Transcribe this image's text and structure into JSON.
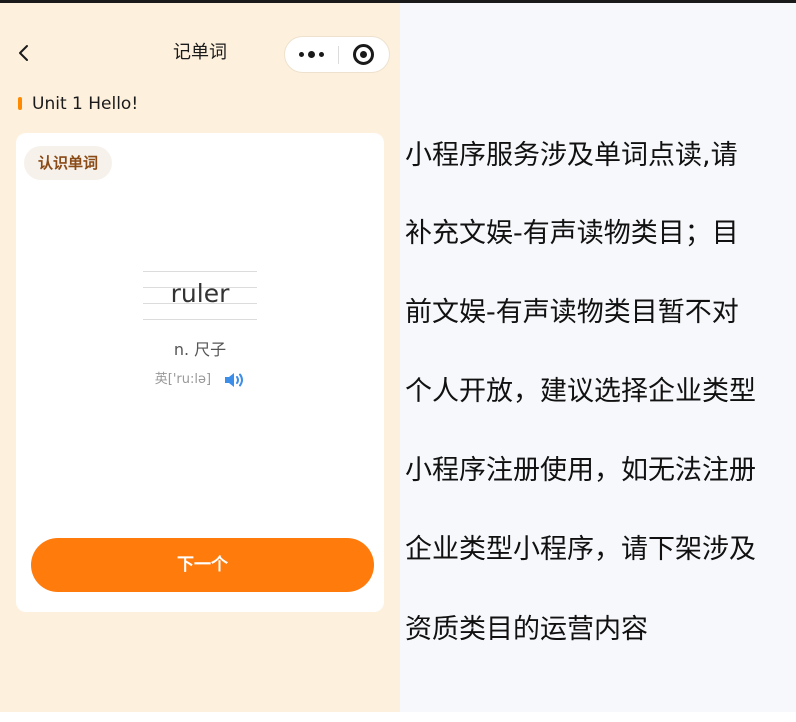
{
  "nav": {
    "title": "记单词",
    "back_icon": "chevron-left-icon",
    "more_icon": "more-dots-icon",
    "close_icon": "target-circle-icon"
  },
  "unit": {
    "label": "Unit 1 Hello!"
  },
  "card": {
    "badge": "认识单词",
    "word": "ruler",
    "meaning": "n. 尺子",
    "phonetic": "英['ru:lə]",
    "speaker_icon": "speaker-icon",
    "next_label": "下一个"
  },
  "colors": {
    "accent": "#ff7b0c",
    "phone_background": "#fdf0dd",
    "badge_text": "#8a4a16"
  },
  "message": {
    "lines": [
      "小程序服务涉及单词点读,请",
      "补充文娱-有声读物类目；目",
      "前文娱-有声读物类目暂不对",
      "个人开放，建议选择企业类型",
      "小程序注册使用，如无法注册",
      "企业类型小程序，请下架涉及",
      "资质类目的运营内容"
    ]
  }
}
